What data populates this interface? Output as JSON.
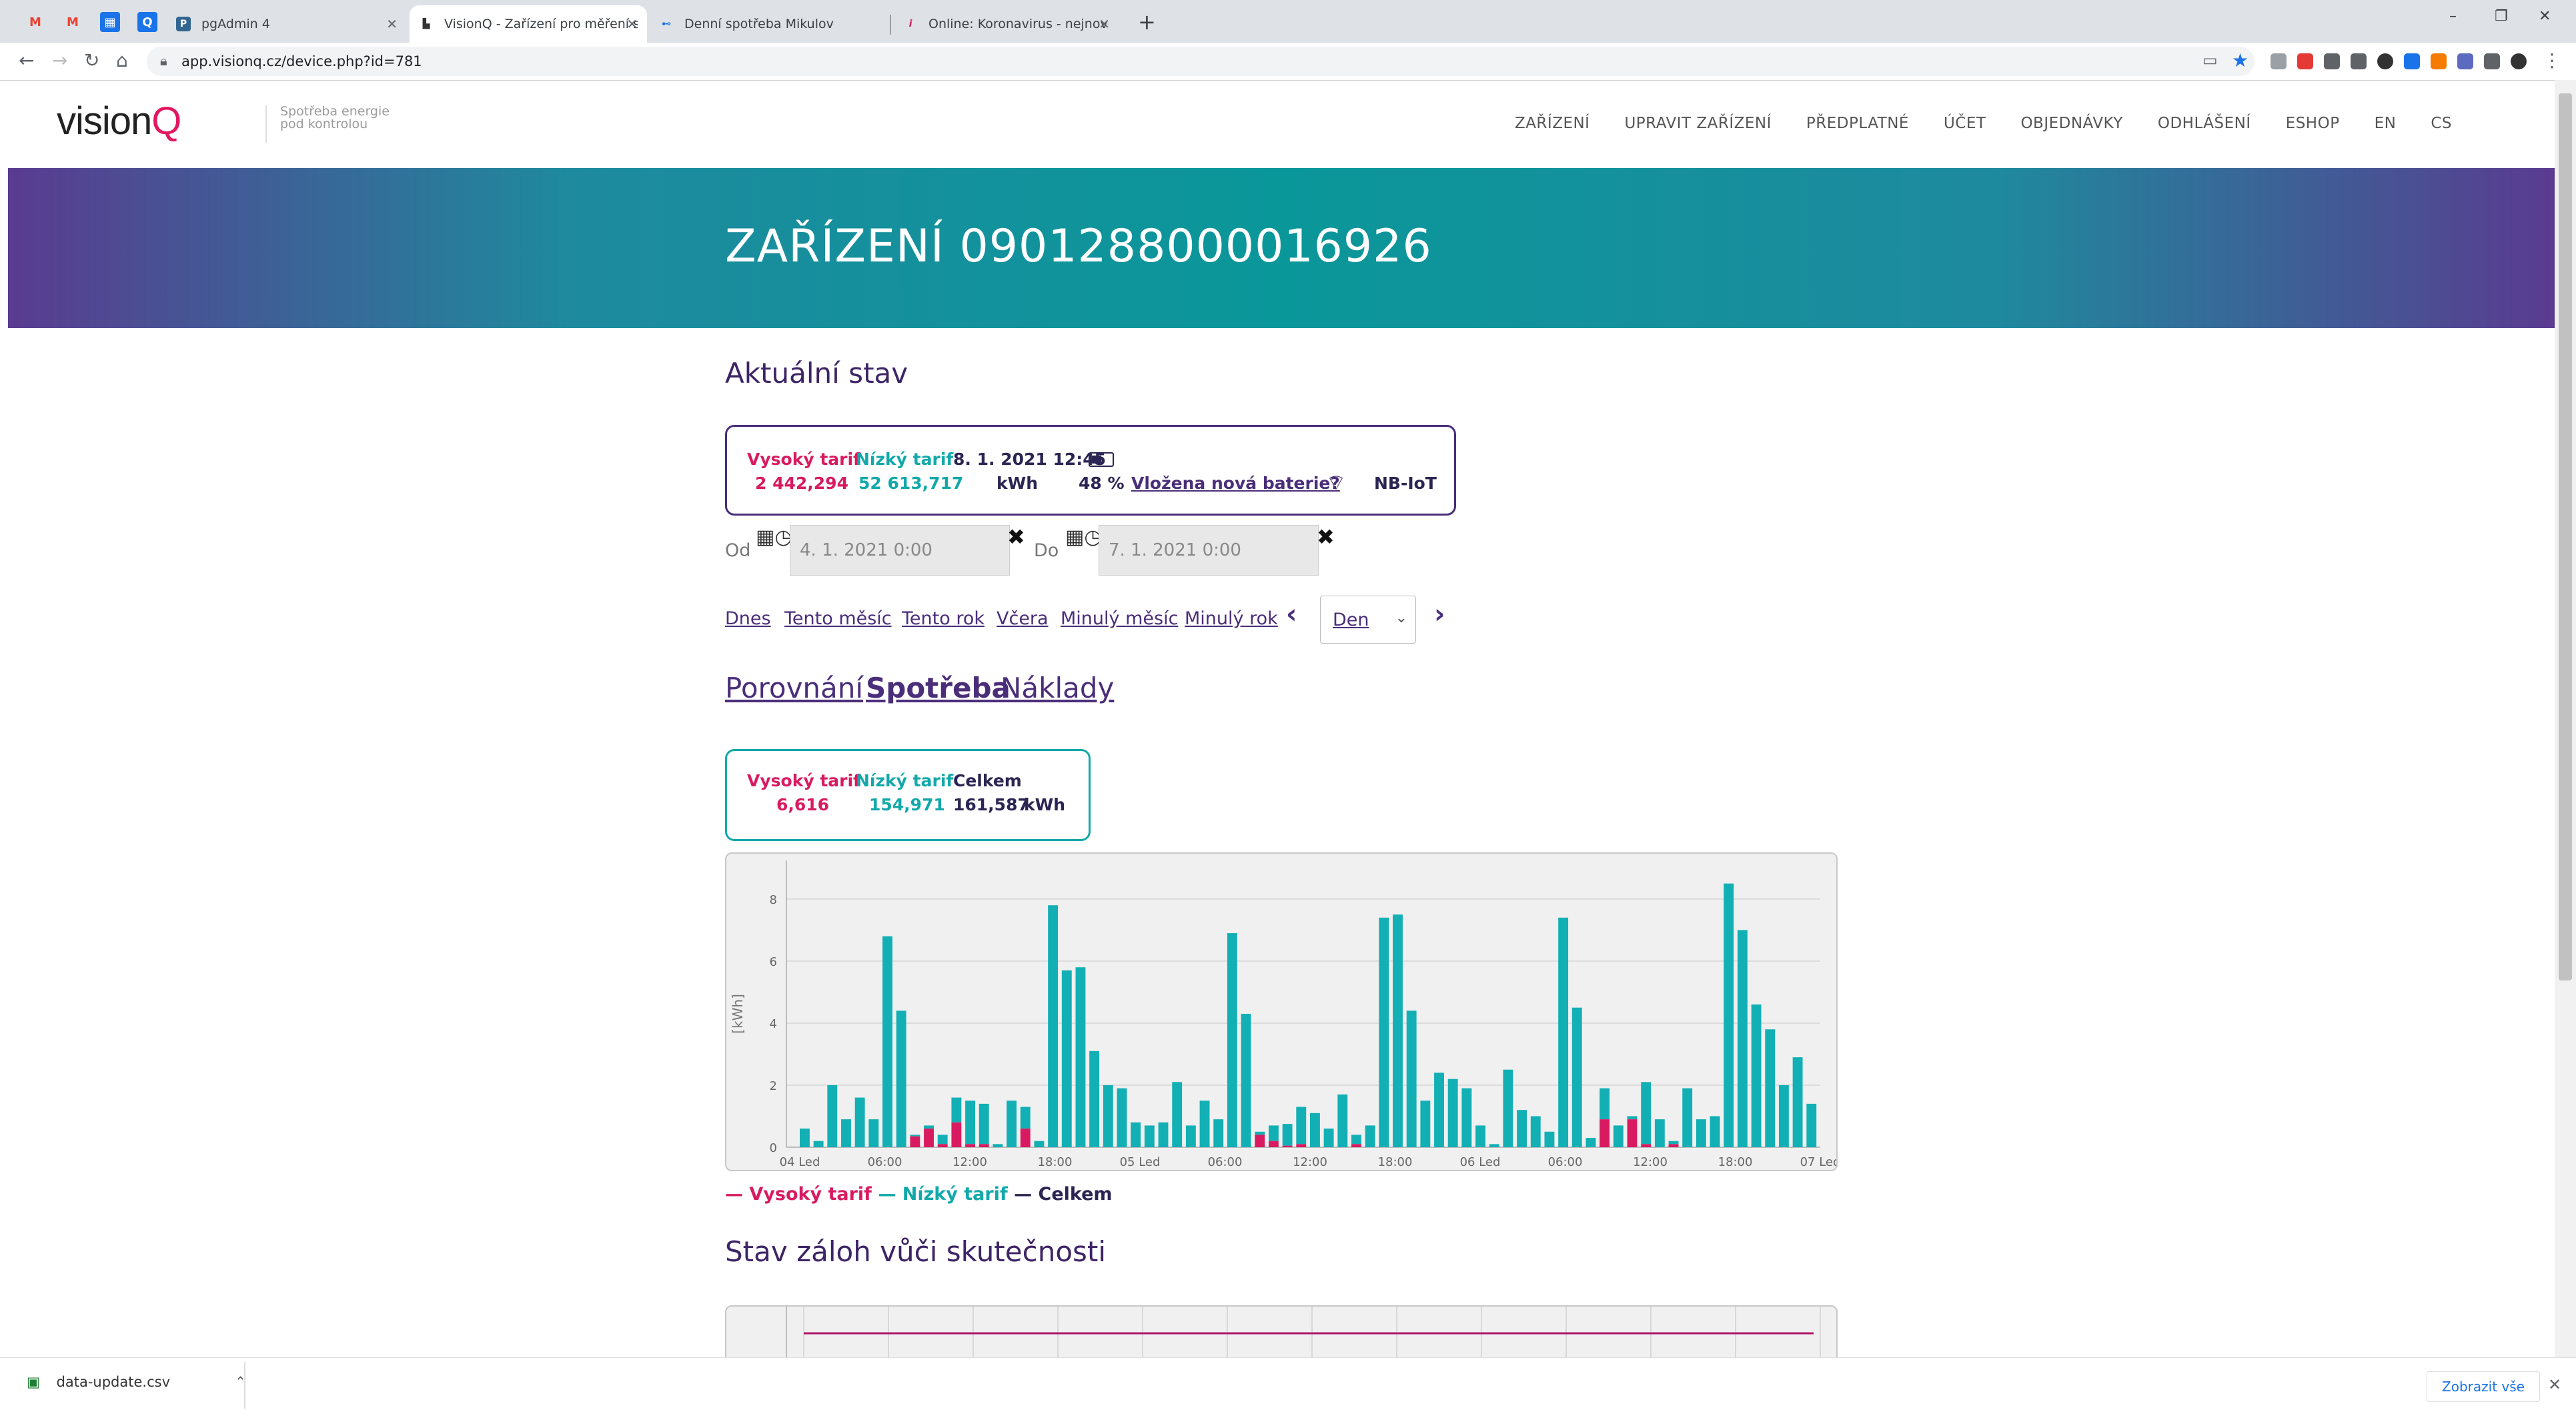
{
  "browser": {
    "tabs": [
      {
        "title": "pgAdmin 4",
        "active": false
      },
      {
        "title": "VisionQ - Zařízení pro měření sp",
        "active": true
      },
      {
        "title": "Denní spotřeba Mikulov",
        "active": false
      },
      {
        "title": "Online: Koronavirus - nejnovější",
        "active": false
      }
    ],
    "new_tab": "+",
    "url": "app.visionq.cz/device.php?id=781"
  },
  "site": {
    "logo_text": "vision",
    "logo_q": "Q",
    "tagline_1": "Spotřeba energie",
    "tagline_2": "pod kontrolou",
    "nav": [
      "ZAŘÍZENÍ",
      "UPRAVIT ZAŘÍZENÍ",
      "PŘEDPLATNÉ",
      "ÚČET",
      "OBJEDNÁVKY",
      "ODHLÁŠENÍ",
      "ESHOP",
      "EN",
      "CS"
    ]
  },
  "banner": {
    "title": "ZAŘÍZENÍ 0901288000016926"
  },
  "current_state": {
    "heading": "Aktuální stav",
    "high_tariff_label": "Vysoký tarif",
    "high_tariff_value": "2 442,294",
    "low_tariff_label": "Nízký tarif",
    "low_tariff_value": "52 613,717",
    "timestamp": "8. 1. 2021 12:45",
    "unit": "kWh",
    "battery_percent": "48 %",
    "battery_link": "Vložena nová baterie?",
    "network": "NB-IoT"
  },
  "filter": {
    "from_label": "Od",
    "from_value": "4. 1. 2021 0:00",
    "to_label": "Do",
    "to_value": "7. 1. 2021 0:00",
    "quick_links": [
      "Dnes",
      "Tento měsíc",
      "Tento rok",
      "Včera",
      "Minulý měsíc",
      "Minulý rok"
    ],
    "period_value": "Den"
  },
  "view_tabs": [
    {
      "label": "Porovnání",
      "active": false
    },
    {
      "label": "Spotřeba",
      "active": true
    },
    {
      "label": "Náklady",
      "active": false
    }
  ],
  "summary": {
    "high_label": "Vysoký tarif",
    "high_value": "6,616",
    "low_label": "Nízký tarif",
    "low_value": "154,971",
    "total_label": "Celkem",
    "total_value": "161,587",
    "unit": "kWh"
  },
  "legend": {
    "high": "— Vysoký tarif",
    "low": "— Nízký tarif",
    "total": "— Celkem"
  },
  "colors": {
    "high": "#d81b60",
    "low": "#12b0b5",
    "total": "#2b2553",
    "accent": "#4a2e7a"
  },
  "chart_data": {
    "type": "bar",
    "ylabel": "[kWh]",
    "ylim": [
      0,
      8.6
    ],
    "yticks": [
      0,
      2,
      4,
      6,
      8
    ],
    "xtick_labels": [
      "04 Led",
      "06:00",
      "12:00",
      "18:00",
      "05 Led",
      "06:00",
      "12:00",
      "18:00",
      "06 Led",
      "06:00",
      "12:00",
      "18:00",
      "07 Led"
    ],
    "series": [
      {
        "name": "Nízký tarif",
        "values": [
          0.6,
          0.2,
          2.0,
          0.9,
          1.6,
          0.9,
          6.8,
          4.4,
          0.05,
          0.1,
          0.3,
          0.8,
          1.4,
          1.3,
          0.1,
          1.5,
          0.7,
          0.2,
          7.8,
          5.7,
          5.8,
          3.1,
          2.0,
          1.9,
          0.8,
          0.7,
          0.8,
          2.1,
          0.7,
          1.5,
          0.9,
          6.9,
          4.3,
          0.1,
          0.5,
          0.7,
          1.2,
          1.1,
          0.6,
          1.7,
          0.3,
          0.7,
          7.4,
          7.5,
          4.4,
          1.5,
          2.4,
          2.2,
          1.9,
          0.7,
          0.1,
          2.5,
          1.2,
          1.0,
          0.5,
          7.4,
          4.5,
          0.3,
          1.0,
          0.7,
          0.1,
          2.0,
          0.9,
          0.1,
          1.9,
          0.9,
          1.0,
          8.5,
          7.0,
          4.6,
          3.8,
          2.0,
          2.9,
          1.4
        ]
      },
      {
        "name": "Vysoký tarif",
        "values": [
          0,
          0,
          0,
          0,
          0,
          0,
          0,
          0,
          0.35,
          0.6,
          0.1,
          0.8,
          0.1,
          0.1,
          0,
          0,
          0.6,
          0,
          0,
          0,
          0,
          0,
          0,
          0,
          0,
          0,
          0,
          0,
          0,
          0,
          0,
          0,
          0,
          0.4,
          0.2,
          0.05,
          0.1,
          0,
          0,
          0,
          0.1,
          0,
          0,
          0,
          0,
          0,
          0,
          0,
          0,
          0,
          0,
          0,
          0,
          0,
          0,
          0,
          0,
          0,
          0.9,
          0,
          0.9,
          0.1,
          0,
          0.1,
          0,
          0,
          0,
          0,
          0,
          0,
          0,
          0,
          0,
          0
        ]
      }
    ]
  },
  "deposits": {
    "heading": "Stav záloh vůči skutečnosti"
  },
  "download": {
    "filename": "data-update.csv",
    "show_all": "Zobrazit vše"
  }
}
